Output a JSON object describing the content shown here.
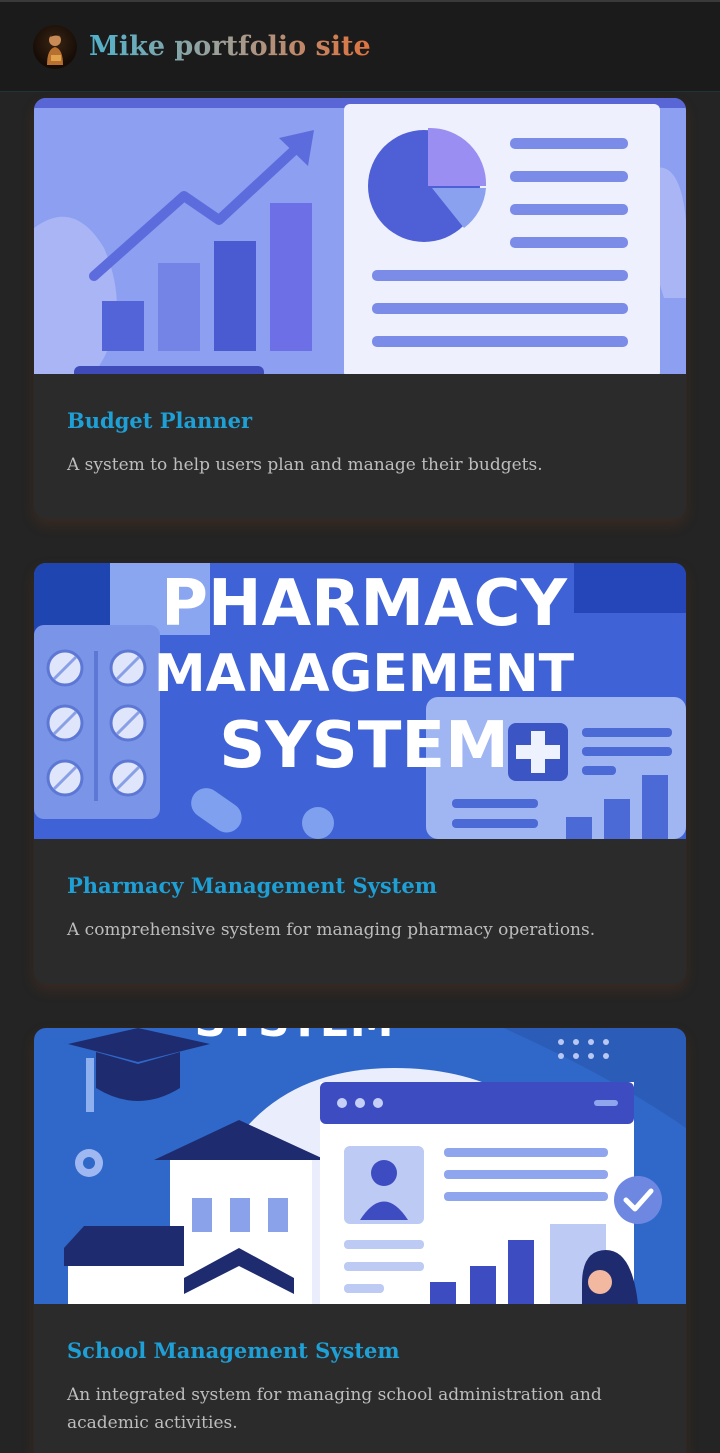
{
  "site": {
    "title": "Mike portfolio site",
    "avatar_icon": "person-avatar-icon"
  },
  "projects": [
    {
      "title": "Budget Planner",
      "description": "A system to help users plan and manage their budgets.",
      "image_icon": "budget-chart-illustration"
    },
    {
      "title": "Pharmacy Management System",
      "description": "A comprehensive system for managing pharmacy operations.",
      "image_icon": "pharmacy-illustration",
      "image_text": [
        "PHARMACY",
        "MANAGEMENT",
        "SYSTEM"
      ]
    },
    {
      "title": "School Management System",
      "description": "An integrated system for managing school administration and academic activities.",
      "image_icon": "school-illustration",
      "image_text": [
        "SYSTEM"
      ]
    }
  ],
  "colors": {
    "background": "#242424",
    "card": "#2b2b2b",
    "title": "#1e9fd6",
    "description": "#bdbdbd"
  }
}
